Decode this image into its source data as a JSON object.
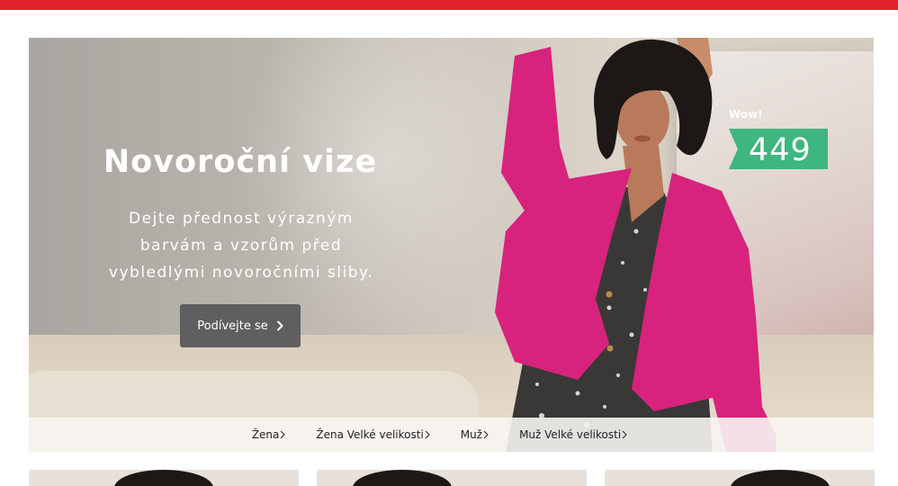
{
  "hero": {
    "title": "Novoroční vize",
    "subtitle_lines": [
      "Dejte přednost výrazným",
      "barvám a vzorům před",
      "vybledlými novoročními sliby."
    ],
    "cta_label": "Podívejte se",
    "cta_icon": "chevron-right-icon",
    "price_badge": {
      "eyebrow": "Wow!",
      "value": "449",
      "color": "#3fb57f"
    }
  },
  "categories": [
    {
      "label": "Žena",
      "icon": "chevron-right-icon"
    },
    {
      "label": "Žena Velké velikosti",
      "icon": "chevron-right-icon"
    },
    {
      "label": "Muž",
      "icon": "chevron-right-icon"
    },
    {
      "label": "Muž Velké velikosti",
      "icon": "chevron-right-icon"
    }
  ],
  "colors": {
    "top_bar": "#e1222b",
    "cta_background": "#5f5f5f",
    "cardigan": "#d7237d"
  }
}
